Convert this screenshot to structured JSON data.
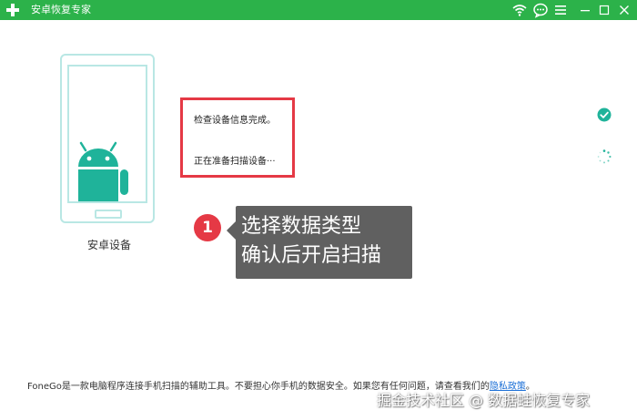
{
  "window": {
    "title": "安卓恢复专家",
    "accent_color": "#2cb24a",
    "controls": [
      "wifi-icon",
      "chat-icon",
      "menu-icon",
      "minimize-icon",
      "maximize-icon",
      "close-icon"
    ]
  },
  "device": {
    "label": "安卓设备",
    "outline_color": "#b9e7e4",
    "robot_color": "#1fb39a"
  },
  "status": {
    "line1": "检查设备信息完成。",
    "line2": "正在准备扫描设备···",
    "line1_state": "done",
    "line2_state": "loading",
    "highlight_color": "#e53945"
  },
  "annotation": {
    "number": "1",
    "line1": "选择数据类型",
    "line2": "确认后开启扫描"
  },
  "footer": {
    "text": "FoneGo是一款电脑程序连接手机扫描的辅助工具。不要担心你手机的数据安全。如果您有任何问题，请查看我们的",
    "link": "隐私政策",
    "suffix": "。"
  },
  "watermark": "掘金技术社区 @ 数据蛙恢复专家"
}
